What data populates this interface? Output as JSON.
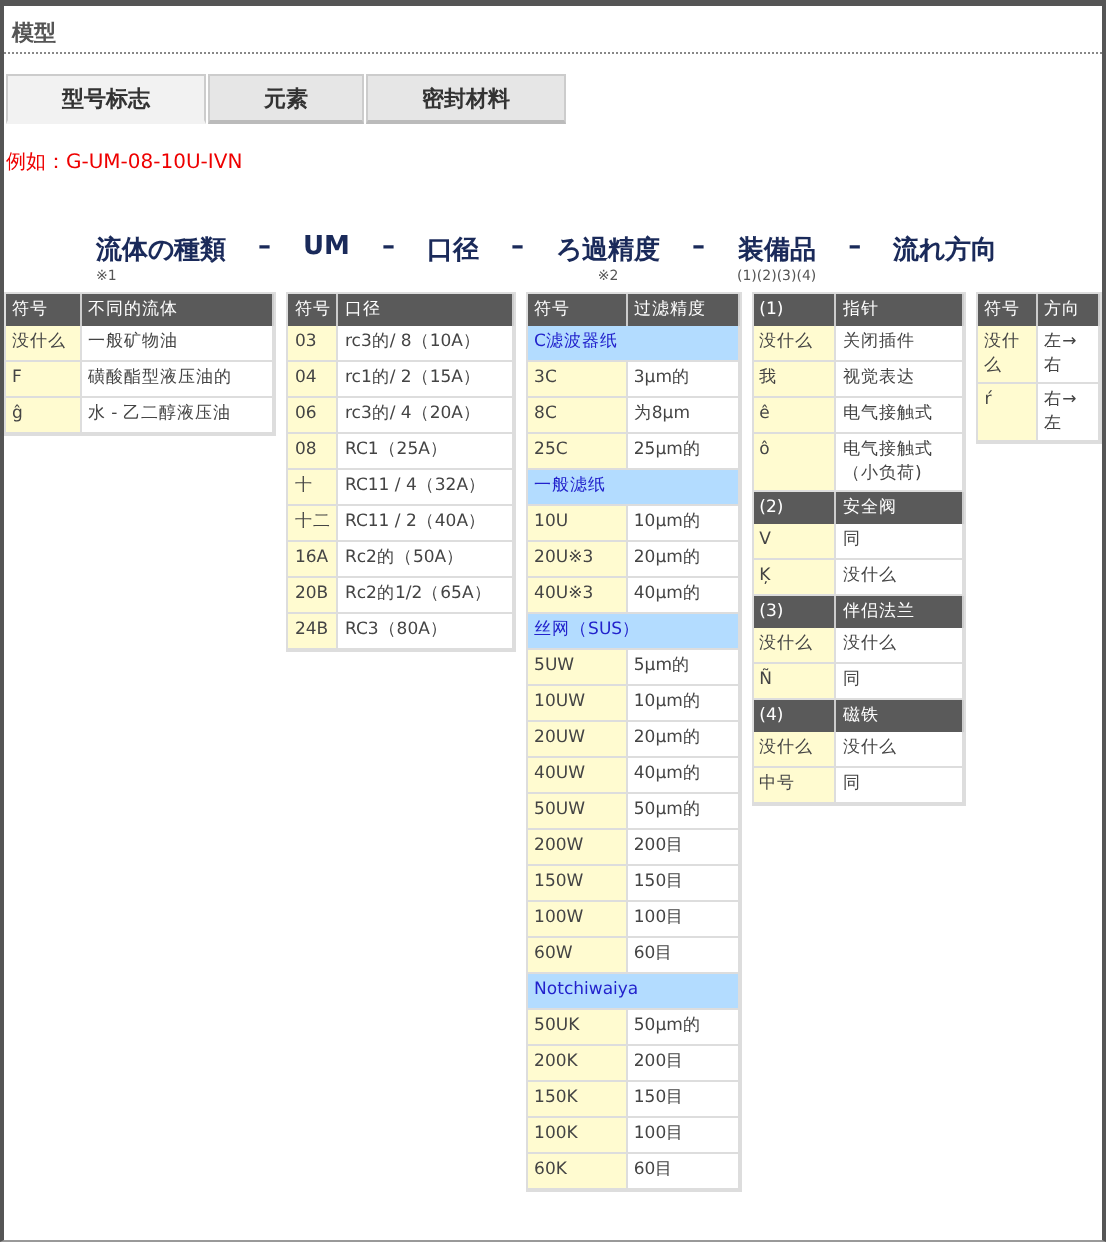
{
  "page_title": "模型",
  "tabs": [
    {
      "label": "型号标志",
      "selected": true
    },
    {
      "label": "元素",
      "selected": false
    },
    {
      "label": "密封材料",
      "selected": false
    }
  ],
  "example": "例如：G-UM-08-10U-IVN",
  "headings": [
    {
      "kind": "title",
      "text": "流体の種類",
      "note": "※1"
    },
    {
      "kind": "dash",
      "text": "–"
    },
    {
      "kind": "title",
      "text": "UM"
    },
    {
      "kind": "dash",
      "text": "–"
    },
    {
      "kind": "title",
      "text": "口径"
    },
    {
      "kind": "dash",
      "text": "–"
    },
    {
      "kind": "title",
      "text": "ろ過精度",
      "note": "※2"
    },
    {
      "kind": "dash",
      "text": "–"
    },
    {
      "kind": "title",
      "text": "装備品",
      "note": "(1)(2)(3)(4)"
    },
    {
      "kind": "dash",
      "text": "–"
    },
    {
      "kind": "title",
      "text": "流れ方向"
    }
  ],
  "tables": [
    {
      "header": [
        "符号",
        "不同的流体"
      ],
      "rows": [
        {
          "kind": "row",
          "cells": [
            "没什么",
            "一般矿物油"
          ]
        },
        {
          "kind": "row",
          "cells": [
            "F",
            "磺酸酯型液压油的"
          ]
        },
        {
          "kind": "row",
          "cells": [
            "ĝ",
            "水 - 乙二醇液压油"
          ]
        }
      ]
    },
    {
      "header": [
        "符号",
        "口径"
      ],
      "rows": [
        {
          "kind": "row",
          "cells": [
            "03",
            "rc3的/ 8（10A）"
          ]
        },
        {
          "kind": "row",
          "cells": [
            "04",
            "rc1的/ 2（15A）"
          ]
        },
        {
          "kind": "row",
          "cells": [
            "06",
            "rc3的/ 4（20A）"
          ]
        },
        {
          "kind": "row",
          "cells": [
            "08",
            "RC1（25A）"
          ]
        },
        {
          "kind": "row",
          "cells": [
            "十",
            "RC11 / 4（32A）"
          ]
        },
        {
          "kind": "row",
          "cells": [
            "十二",
            "RC11 / 2（40A）"
          ]
        },
        {
          "kind": "row",
          "cells": [
            "16A",
            "Rc2的（50A）"
          ]
        },
        {
          "kind": "row",
          "cells": [
            "20B",
            "Rc2的1/2（65A）"
          ]
        },
        {
          "kind": "row",
          "cells": [
            "24B",
            "RC3（80A）"
          ]
        }
      ]
    },
    {
      "header": [
        "符号",
        "过滤精度"
      ],
      "rows": [
        {
          "kind": "group",
          "cells": [
            {
              "text": "C滤波器纸",
              "colspan": 2
            }
          ]
        },
        {
          "kind": "row",
          "cells": [
            "3C",
            "3μm的"
          ]
        },
        {
          "kind": "row",
          "cells": [
            "8C",
            "为8μm"
          ]
        },
        {
          "kind": "row",
          "cells": [
            "25C",
            "25μm的"
          ]
        },
        {
          "kind": "group",
          "cells": [
            {
              "text": "一般滤纸",
              "colspan": 2
            }
          ]
        },
        {
          "kind": "row",
          "cells": [
            "10U",
            "10μm的"
          ]
        },
        {
          "kind": "row",
          "cells": [
            "20U※3",
            "20μm的"
          ]
        },
        {
          "kind": "row",
          "cells": [
            "40U※3",
            "40μm的"
          ]
        },
        {
          "kind": "group",
          "cells": [
            {
              "text": "丝网（SUS）",
              "colspan": 2
            }
          ]
        },
        {
          "kind": "row",
          "cells": [
            "5UW",
            "5μm的"
          ]
        },
        {
          "kind": "row",
          "cells": [
            "10UW",
            "10μm的"
          ]
        },
        {
          "kind": "row",
          "cells": [
            "20UW",
            "20μm的"
          ]
        },
        {
          "kind": "row",
          "cells": [
            "40UW",
            "40μm的"
          ]
        },
        {
          "kind": "row",
          "cells": [
            "50UW",
            "50μm的"
          ]
        },
        {
          "kind": "row",
          "cells": [
            "200W",
            "200目"
          ]
        },
        {
          "kind": "row",
          "cells": [
            "150W",
            "150目"
          ]
        },
        {
          "kind": "row",
          "cells": [
            "100W",
            "100目"
          ]
        },
        {
          "kind": "row",
          "cells": [
            "60W",
            "60目"
          ]
        },
        {
          "kind": "group",
          "cells": [
            {
              "text": "Notchiwaiya",
              "colspan": 2
            }
          ]
        },
        {
          "kind": "row",
          "cells": [
            "50UK",
            "50μm的"
          ]
        },
        {
          "kind": "row",
          "cells": [
            "200K",
            "200目"
          ]
        },
        {
          "kind": "row",
          "cells": [
            "150K",
            "150目"
          ]
        },
        {
          "kind": "row",
          "cells": [
            "100K",
            "100目"
          ]
        },
        {
          "kind": "row",
          "cells": [
            "60K",
            "60目"
          ]
        }
      ]
    },
    {
      "header": [
        "(1)",
        "指针"
      ],
      "rows": [
        {
          "kind": "row",
          "cells": [
            "没什么",
            "关闭插件"
          ]
        },
        {
          "kind": "row",
          "cells": [
            "我",
            "视觉表达"
          ]
        },
        {
          "kind": "row",
          "cells": [
            "ê",
            "电气接触式"
          ]
        },
        {
          "kind": "row",
          "cells": [
            "ô",
            "电气接触式（小负荷)"
          ]
        },
        {
          "kind": "header",
          "cells": [
            "(2)",
            "安全阀"
          ]
        },
        {
          "kind": "row",
          "cells": [
            "V",
            "同"
          ]
        },
        {
          "kind": "row",
          "cells": [
            "Ķ",
            "没什么"
          ]
        },
        {
          "kind": "header",
          "cells": [
            "(3)",
            "伴侣法兰"
          ]
        },
        {
          "kind": "row",
          "cells": [
            "没什么",
            "没什么"
          ]
        },
        {
          "kind": "row",
          "cells": [
            "Ñ",
            "同"
          ]
        },
        {
          "kind": "header",
          "cells": [
            "(4)",
            "磁铁"
          ]
        },
        {
          "kind": "row",
          "cells": [
            "没什么",
            "没什么"
          ]
        },
        {
          "kind": "row",
          "cells": [
            "中号",
            "同"
          ]
        }
      ]
    },
    {
      "header": [
        "符号",
        "方向"
      ],
      "rows": [
        {
          "kind": "row",
          "cells": [
            "没什么",
            "左→右"
          ]
        },
        {
          "kind": "row",
          "cells": [
            "ŕ",
            "右→左"
          ]
        }
      ]
    }
  ]
}
